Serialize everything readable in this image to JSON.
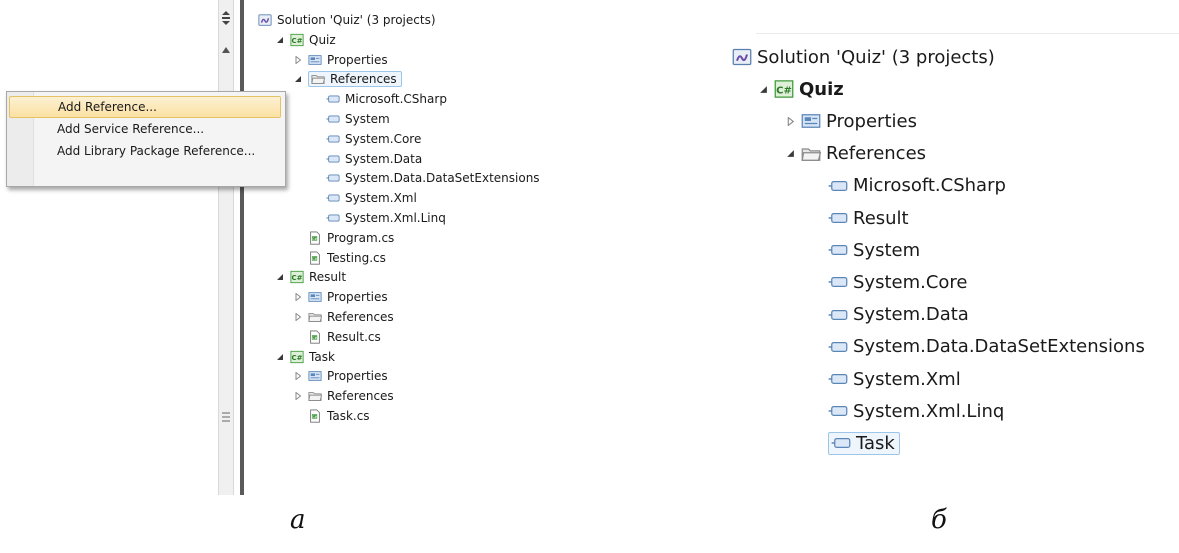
{
  "panel_a": {
    "tree": [
      {
        "label": "Solution 'Quiz' (3 projects)",
        "icon": "solution-icon",
        "indent": 0,
        "arrow": "none"
      },
      {
        "label": "Quiz",
        "icon": "csharp-project-icon",
        "indent": 1,
        "arrow": "expanded"
      },
      {
        "label": "Properties",
        "icon": "properties-icon",
        "indent": 2,
        "arrow": "collapsed"
      },
      {
        "label": "References",
        "icon": "references-folder-icon",
        "indent": 2,
        "arrow": "expanded",
        "selected": true
      },
      {
        "label": "Microsoft.CSharp",
        "icon": "reference-icon",
        "indent": 3,
        "arrow": "none"
      },
      {
        "label": "System",
        "icon": "reference-icon",
        "indent": 3,
        "arrow": "none"
      },
      {
        "label": "System.Core",
        "icon": "reference-icon",
        "indent": 3,
        "arrow": "none"
      },
      {
        "label": "System.Data",
        "icon": "reference-icon",
        "indent": 3,
        "arrow": "none"
      },
      {
        "label": "System.Data.DataSetExtensions",
        "icon": "reference-icon",
        "indent": 3,
        "arrow": "none"
      },
      {
        "label": "System.Xml",
        "icon": "reference-icon",
        "indent": 3,
        "arrow": "none"
      },
      {
        "label": "System.Xml.Linq",
        "icon": "reference-icon",
        "indent": 3,
        "arrow": "none"
      },
      {
        "label": "Program.cs",
        "icon": "cs-file-icon",
        "indent": 2,
        "arrow": "none"
      },
      {
        "label": "Testing.cs",
        "icon": "cs-file-icon",
        "indent": 2,
        "arrow": "none"
      },
      {
        "label": "Result",
        "icon": "csharp-project-icon",
        "indent": 1,
        "arrow": "expanded"
      },
      {
        "label": "Properties",
        "icon": "properties-icon",
        "indent": 2,
        "arrow": "collapsed"
      },
      {
        "label": "References",
        "icon": "references-folder-icon",
        "indent": 2,
        "arrow": "collapsed"
      },
      {
        "label": "Result.cs",
        "icon": "cs-file-icon",
        "indent": 2,
        "arrow": "none"
      },
      {
        "label": "Task",
        "icon": "csharp-project-icon",
        "indent": 1,
        "arrow": "expanded"
      },
      {
        "label": "Properties",
        "icon": "properties-icon",
        "indent": 2,
        "arrow": "collapsed"
      },
      {
        "label": "References",
        "icon": "references-folder-icon",
        "indent": 2,
        "arrow": "collapsed"
      },
      {
        "label": "Task.cs",
        "icon": "cs-file-icon",
        "indent": 2,
        "arrow": "none"
      }
    ],
    "context_menu": {
      "items": [
        {
          "label": "Add Reference...",
          "highlighted": true
        },
        {
          "label": "Add Service Reference..."
        },
        {
          "label": "Add Library Package Reference..."
        }
      ]
    },
    "caption": "а"
  },
  "panel_b": {
    "tree": [
      {
        "label": "Solution 'Quiz' (3 projects)",
        "icon": "solution-icon",
        "indent": 0,
        "arrow": "none"
      },
      {
        "label": "Quiz",
        "icon": "csharp-project-icon",
        "indent": 1,
        "arrow": "expanded",
        "bold": true
      },
      {
        "label": "Properties",
        "icon": "properties-icon",
        "indent": 2,
        "arrow": "collapsed"
      },
      {
        "label": "References",
        "icon": "references-folder-icon",
        "indent": 2,
        "arrow": "expanded"
      },
      {
        "label": "Microsoft.CSharp",
        "icon": "reference-icon",
        "indent": 3,
        "arrow": "none"
      },
      {
        "label": "Result",
        "icon": "reference-icon",
        "indent": 3,
        "arrow": "none"
      },
      {
        "label": "System",
        "icon": "reference-icon",
        "indent": 3,
        "arrow": "none"
      },
      {
        "label": "System.Core",
        "icon": "reference-icon",
        "indent": 3,
        "arrow": "none"
      },
      {
        "label": "System.Data",
        "icon": "reference-icon",
        "indent": 3,
        "arrow": "none"
      },
      {
        "label": "System.Data.DataSetExtensions",
        "icon": "reference-icon",
        "indent": 3,
        "arrow": "none"
      },
      {
        "label": "System.Xml",
        "icon": "reference-icon",
        "indent": 3,
        "arrow": "none"
      },
      {
        "label": "System.Xml.Linq",
        "icon": "reference-icon",
        "indent": 3,
        "arrow": "none"
      },
      {
        "label": "Task",
        "icon": "reference-icon",
        "indent": 3,
        "arrow": "none",
        "selected": true
      }
    ],
    "caption": "б"
  },
  "colors": {
    "menu_highlight": "#fbe1a2",
    "selection_border": "#9cc5e8",
    "project_icon_green": "#3f9a3a",
    "reference_icon_blue": "#5b86b8"
  }
}
